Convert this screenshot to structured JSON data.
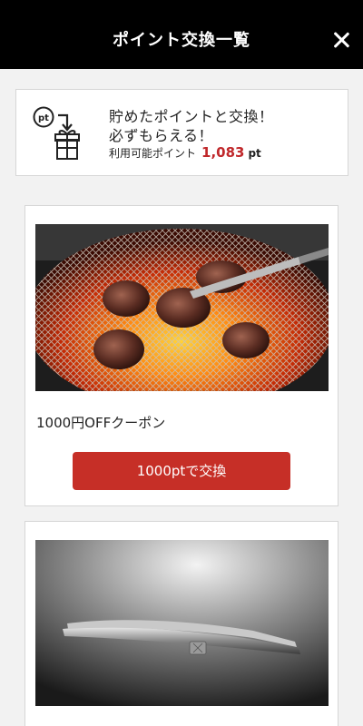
{
  "header": {
    "title": "ポイント交換一覧",
    "close_icon": "close-icon"
  },
  "summary": {
    "icon": "points-gift-icon",
    "line1": "貯めたポイントと交換！",
    "line2": "必ずもらえる！",
    "points_label": "利用可能ポイント",
    "points_value": "1,083",
    "points_unit": "pt"
  },
  "rewards": [
    {
      "image": "grilled-meat-photo",
      "title": "1000円OFFクーポン",
      "button_label": "1000ptで交換"
    },
    {
      "image": "steel-tongs-photo",
      "title": "",
      "button_label": ""
    }
  ],
  "colors": {
    "header_bg": "#000000",
    "accent_red": "#c62f27",
    "points_red": "#c0282b",
    "page_bg": "#f2f2f2"
  }
}
